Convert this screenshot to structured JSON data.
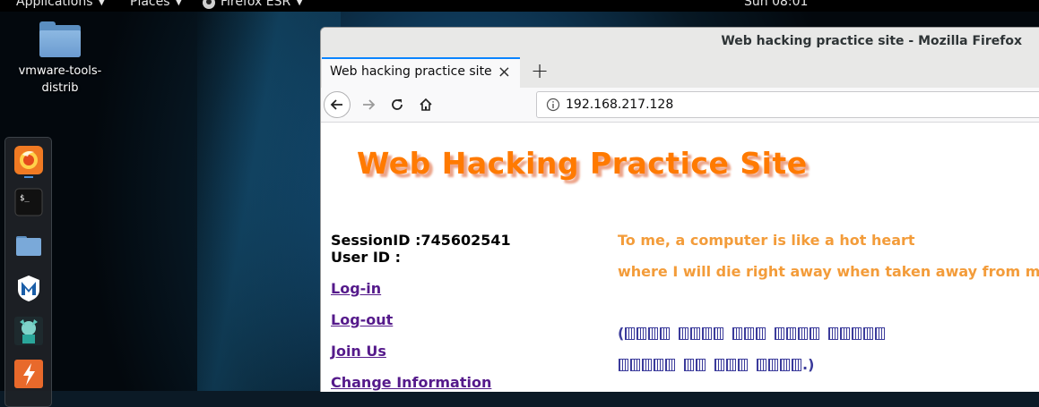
{
  "top_panel": {
    "applications": "Applications",
    "places": "Places",
    "firefox": "Firefox ESR",
    "clock": "Sun 08:01"
  },
  "desktop": {
    "icon_label_line1": "vmware-tools-",
    "icon_label_line2": "distrib"
  },
  "dock": {
    "items": [
      "firefox-icon",
      "terminal-icon",
      "files-icon",
      "metasploit-icon",
      "armitage-icon",
      "burpsuite-icon"
    ]
  },
  "window": {
    "title": "Web hacking practice site - Mozilla Firefox"
  },
  "tab": {
    "title": "Web hacking practice site",
    "close": "×",
    "new_tab": "+"
  },
  "nav": {
    "url": "192.168.217.128"
  },
  "page": {
    "site_title": "Web Hacking Practice Site",
    "session_line": "SessionID :745602541",
    "user_line": "User ID :",
    "links": [
      "Log-in",
      "Log-out",
      "Join Us",
      "Change Information"
    ],
    "quote1": "To me, a computer is like a hot heart",
    "quote2": "where I will die right away when taken away from m",
    "kr_open": "(",
    "kr_close": ".)",
    "kr_dot": "."
  },
  "colors": {
    "accent_tab": "#0a84ff",
    "site_title": "#ff7a00",
    "quote": "#f39c3a",
    "link": "#551a8b"
  }
}
